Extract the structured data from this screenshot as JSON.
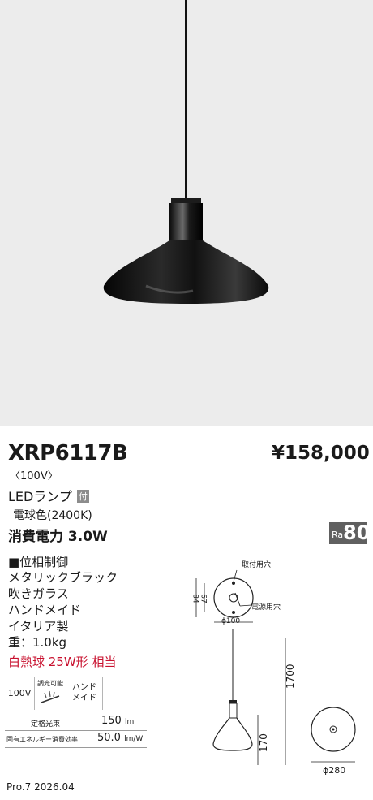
{
  "product": {
    "model": "XRP6117B",
    "price": "¥158,000",
    "voltage": "〈100V〉",
    "lamp": "LEDランプ",
    "lamp_badge": "付",
    "light_color": "電球色(2400K)",
    "power": "消費電力 3.0W",
    "ra_label": "Ra",
    "ra_value": "80"
  },
  "specs": [
    "■位相制御",
    "メタリックブラック",
    "吹きガラス",
    "ハンドメイド",
    "イタリア製",
    "重：1.0kg"
  ],
  "equivalent": "白熱球 25W形 相当",
  "features": {
    "voltage": "100V",
    "dimmable_label": "調光可能",
    "handmade_line1": "ハンド",
    "handmade_line2": "メイド"
  },
  "table": {
    "rated_flux_label": "定格光束",
    "rated_flux_value": "150",
    "rated_flux_unit": "lm",
    "efficiency_label": "固有エネルギー消費効率",
    "efficiency_value": "50.0",
    "efficiency_unit": "lm/W"
  },
  "drawing": {
    "mount_hole": "取付用穴",
    "power_hole": "電源用穴",
    "dim_84": "84",
    "dim_67": "67",
    "dim_100": "ϕ100",
    "dim_1700": "1700",
    "dim_170": "170",
    "dim_280": "ϕ280"
  },
  "footer": "Pro.7 2026.04"
}
